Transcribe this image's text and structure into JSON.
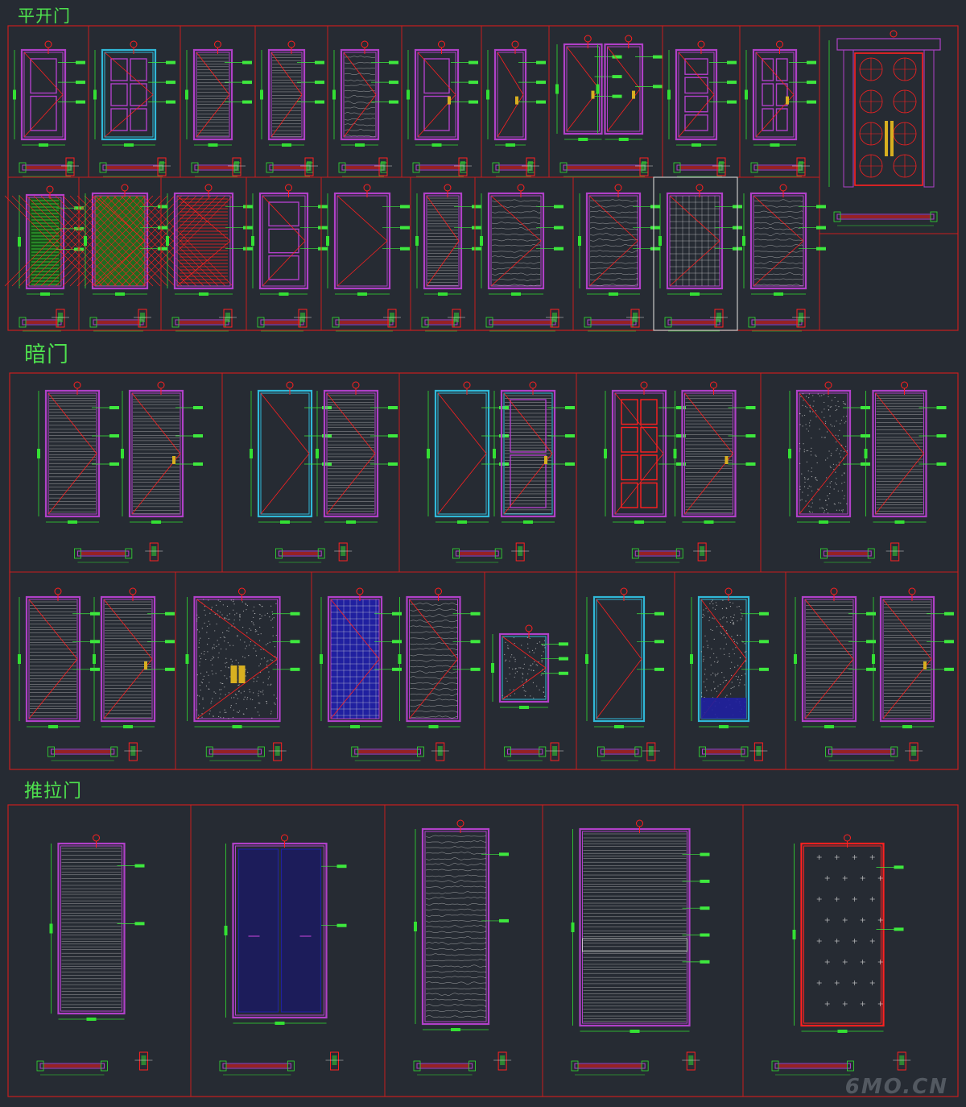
{
  "sections": [
    {
      "title": "平开门"
    },
    {
      "title": "暗门"
    },
    {
      "title": "推拉门"
    }
  ],
  "watermark": "6MO.CN",
  "colors": {
    "background": "#262b33",
    "frame_red": "#c81e1e",
    "dim_green": "#33e033",
    "door_magenta": "#b040c8",
    "door_cyan": "#30b8d8",
    "hatch_white": "#d8d8d8",
    "accent_red": "#ff2020",
    "gold": "#d8b020",
    "lime": "#3ee83e",
    "blue": "#2020a0"
  }
}
